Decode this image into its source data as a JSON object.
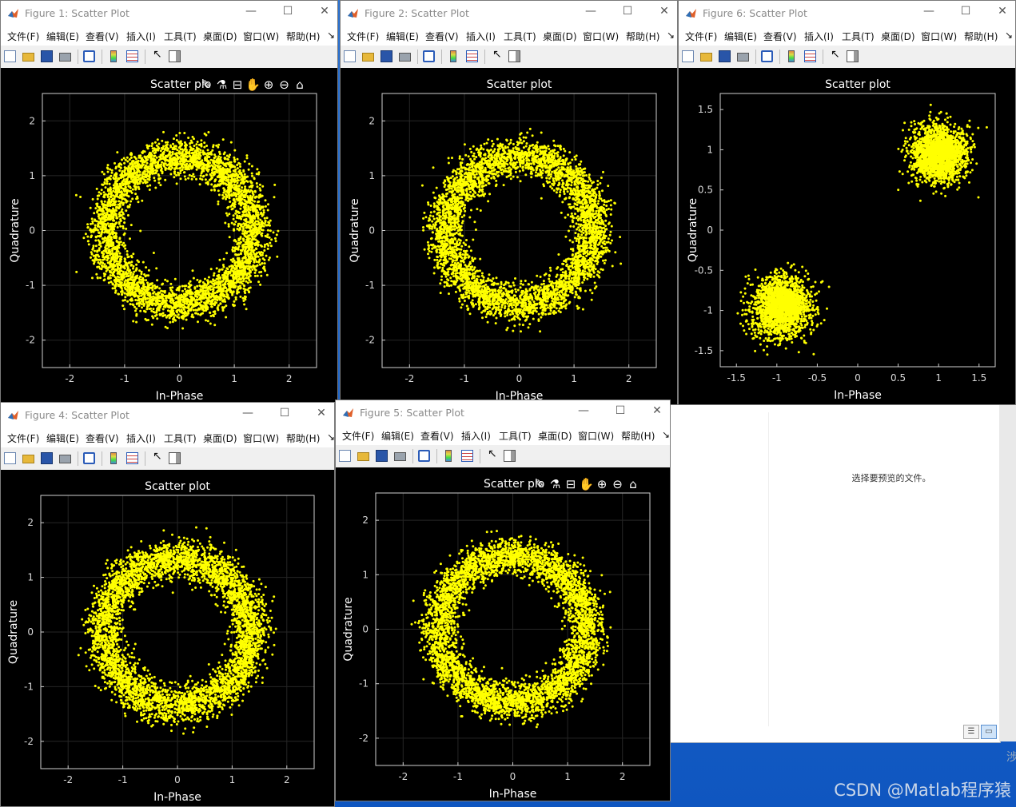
{
  "menu": [
    "文件(F)",
    "编辑(E)",
    "查看(V)",
    "插入(I)",
    "工具(T)",
    "桌面(D)",
    "窗口(W)",
    "帮助(H)"
  ],
  "menu_overflow": "↘",
  "icons": [
    "new-file-icon",
    "open-folder-icon",
    "save-icon",
    "print-icon",
    "link-figure-icon",
    "colorbar-icon",
    "legend-icon",
    "pointer-arrow-icon",
    "property-panel-icon"
  ],
  "axes_toolbar_icons": [
    "brush-icon",
    "data-tips-icon",
    "property-icon",
    "pan-hand-icon",
    "zoom-in-icon",
    "zoom-out-icon",
    "home-icon"
  ],
  "colors": {
    "marker": "#ffff00",
    "axes_bg": "#000000",
    "grid": "#262626",
    "figure_bg": "#000000"
  },
  "figures": [
    {
      "id": "fig1",
      "window_title": "Figure 1: Scatter Plot",
      "plot_title": "Scatter plo",
      "axes_toolbar": true,
      "xlabel": "In-Phase",
      "ylabel": "Quadrature",
      "chart_data": {
        "type": "scatter",
        "shape": "ring",
        "center": [
          0,
          0
        ],
        "inner_radius": 0.95,
        "outer_radius": 1.75,
        "xlim": [
          -2.5,
          2.5
        ],
        "ylim": [
          -2.5,
          2.5
        ],
        "xticks": [
          -2,
          -1,
          0,
          1,
          2
        ],
        "yticks": [
          -2,
          -1,
          0,
          1,
          2
        ],
        "grid": true
      }
    },
    {
      "id": "fig2",
      "window_title": "Figure 2: Scatter Plot",
      "plot_title": "Scatter plot",
      "axes_toolbar": false,
      "xlabel": "In-Phase",
      "ylabel": "Quadrature",
      "chart_data": {
        "type": "scatter",
        "shape": "ring",
        "center": [
          0,
          0
        ],
        "inner_radius": 0.95,
        "outer_radius": 1.75,
        "xlim": [
          -2.5,
          2.5
        ],
        "ylim": [
          -2.5,
          2.5
        ],
        "xticks": [
          -2,
          -1,
          0,
          1,
          2
        ],
        "yticks": [
          -2,
          -1,
          0,
          1,
          2
        ],
        "grid": true
      }
    },
    {
      "id": "fig6",
      "window_title": "Figure 6: Scatter Plot",
      "plot_title": "Scatter plot",
      "axes_toolbar": false,
      "xlabel": "In-Phase",
      "ylabel": "Quadrature",
      "chart_data": {
        "type": "scatter",
        "shape": "clusters",
        "clusters": [
          {
            "center": [
              1.0,
              0.95
            ],
            "radius": 0.42
          },
          {
            "center": [
              -0.95,
              -0.95
            ],
            "radius": 0.45
          }
        ],
        "xlim": [
          -1.7,
          1.7
        ],
        "ylim": [
          -1.7,
          1.7
        ],
        "xticks": [
          -1.5,
          -1,
          -0.5,
          0,
          0.5,
          1,
          1.5
        ],
        "yticks": [
          -1.5,
          -1,
          -0.5,
          0,
          0.5,
          1,
          1.5
        ],
        "grid": false
      }
    },
    {
      "id": "fig4",
      "window_title": "Figure 4: Scatter Plot",
      "plot_title": "Scatter plot",
      "axes_toolbar": false,
      "xlabel": "In-Phase",
      "ylabel": "Quadrature",
      "chart_data": {
        "type": "scatter",
        "shape": "ring",
        "center": [
          0,
          0
        ],
        "inner_radius": 0.95,
        "outer_radius": 1.75,
        "xlim": [
          -2.5,
          2.5
        ],
        "ylim": [
          -2.5,
          2.5
        ],
        "xticks": [
          -2,
          -1,
          0,
          1,
          2
        ],
        "yticks": [
          -2,
          -1,
          0,
          1,
          2
        ],
        "grid": true
      }
    },
    {
      "id": "fig5",
      "window_title": "Figure 5: Scatter Plot",
      "plot_title": "Scatter plo",
      "axes_toolbar": true,
      "xlabel": "In-Phase",
      "ylabel": "Quadrature",
      "chart_data": {
        "type": "scatter",
        "shape": "ring",
        "center": [
          0,
          0
        ],
        "inner_radius": 0.95,
        "outer_radius": 1.75,
        "xlim": [
          -2.5,
          2.5
        ],
        "ylim": [
          -2.5,
          2.5
        ],
        "xticks": [
          -2,
          -1,
          0,
          1,
          2
        ],
        "yticks": [
          -2,
          -1,
          0,
          1,
          2
        ],
        "grid": true
      }
    }
  ],
  "explorer": {
    "preview_message": "选择要预览的文件。"
  },
  "watermark": "CSDN @Matlab程序猿"
}
